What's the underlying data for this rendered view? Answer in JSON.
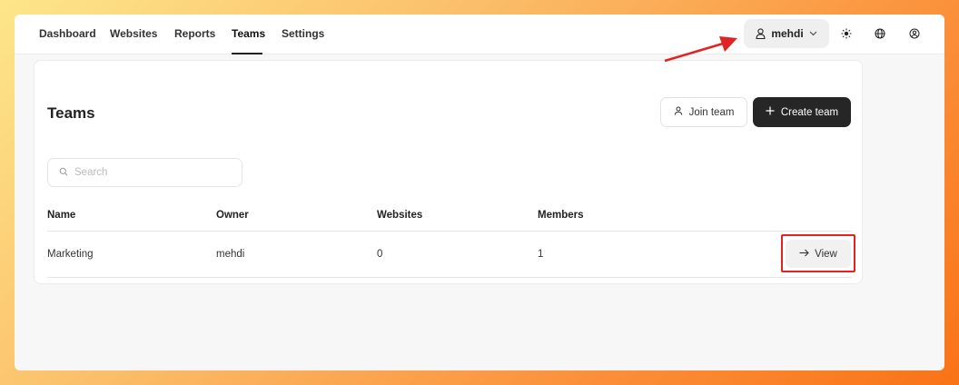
{
  "nav": {
    "items": [
      {
        "label": "Dashboard"
      },
      {
        "label": "Websites"
      },
      {
        "label": "Reports"
      },
      {
        "label": "Teams"
      },
      {
        "label": "Settings"
      }
    ],
    "active": "Teams"
  },
  "user_menu": {
    "username": "mehdi",
    "icon": "user-icon",
    "chevron": "chevron-down-icon"
  },
  "header_icons": [
    "sun-icon",
    "globe-icon",
    "profile-icon"
  ],
  "page": {
    "title": "Teams",
    "join_label": "Join team",
    "create_label": "Create team"
  },
  "search": {
    "placeholder": "Search",
    "value": ""
  },
  "table": {
    "columns": [
      "Name",
      "Owner",
      "Websites",
      "Members"
    ],
    "rows": [
      {
        "name": "Marketing",
        "owner": "mehdi",
        "websites": "0",
        "members": "1",
        "action": "View"
      }
    ]
  },
  "annotations": {
    "color": "#e02424"
  },
  "colors": {
    "primary_button": "#262626",
    "background_gradient_start": "#fde68a",
    "background_gradient_end": "#f97316"
  }
}
